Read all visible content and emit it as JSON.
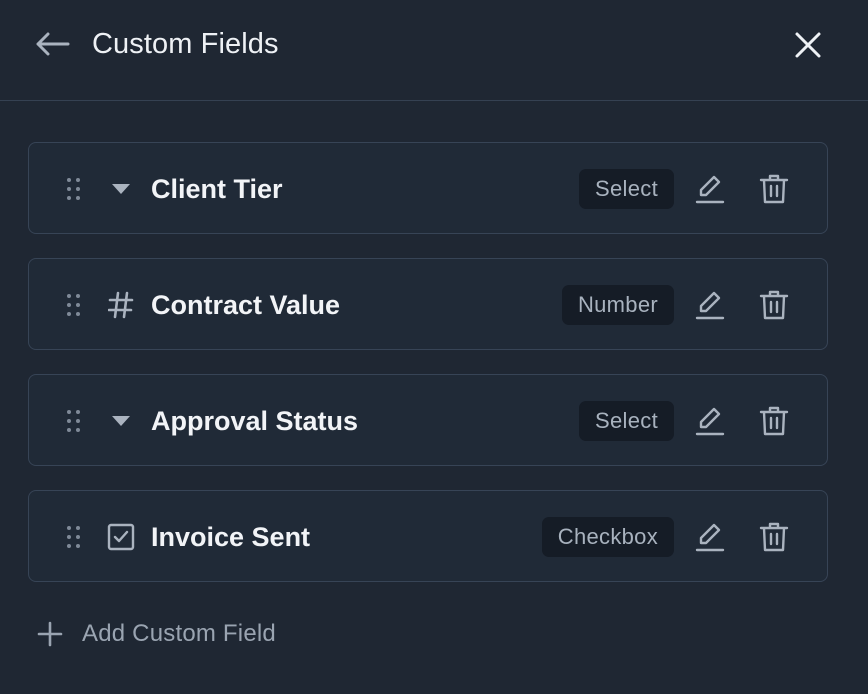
{
  "header": {
    "title": "Custom Fields",
    "back_icon": "arrow-left-icon",
    "close_icon": "close-icon"
  },
  "fields": [
    {
      "name": "Client Tier",
      "type": "Select",
      "type_icon": "dropdown-caret-icon"
    },
    {
      "name": "Contract Value",
      "type": "Number",
      "type_icon": "hash-icon"
    },
    {
      "name": "Approval Status",
      "type": "Select",
      "type_icon": "dropdown-caret-icon"
    },
    {
      "name": "Invoice Sent",
      "type": "Checkbox",
      "type_icon": "checkbox-icon"
    }
  ],
  "add_field": {
    "label": "Add Custom Field"
  },
  "colors": {
    "background": "#1f2733",
    "row_border": "#374456",
    "badge_bg": "#151c26",
    "icon": "#aab3bf",
    "text": "#eef1f5",
    "muted_text": "#9aa4b1"
  }
}
